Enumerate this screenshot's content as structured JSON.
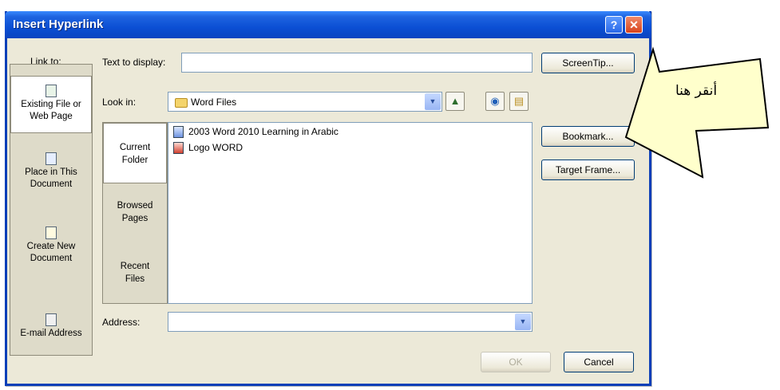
{
  "dialog": {
    "title": "Insert Hyperlink",
    "help_glyph": "?",
    "close_glyph": "✕"
  },
  "link_to": {
    "label": "Link to:",
    "items": [
      {
        "label_line1": "Existing File or",
        "label_line2": "Web Page",
        "icon": "globe-page-icon",
        "active": true
      },
      {
        "label_line1": "Place in This",
        "label_line2": "Document",
        "icon": "document-place-icon",
        "active": false
      },
      {
        "label_line1": "Create New",
        "label_line2": "Document",
        "icon": "new-document-icon",
        "active": false
      },
      {
        "label_line1": "E-mail Address",
        "label_line2": "",
        "icon": "email-icon",
        "active": false
      }
    ]
  },
  "text_to_display": {
    "label": "Text to display:",
    "value": ""
  },
  "look_in": {
    "label": "Look in:",
    "value": "Word Files",
    "icons": [
      "up-folder-icon",
      "browse-web-icon",
      "browse-file-icon"
    ]
  },
  "places": [
    {
      "label_line1": "Current",
      "label_line2": "Folder",
      "active": true
    },
    {
      "label_line1": "Browsed",
      "label_line2": "Pages",
      "active": false
    },
    {
      "label_line1": "Recent",
      "label_line2": "Files",
      "active": false
    }
  ],
  "files": [
    {
      "name": "2003 Word 2010 Learning in Arabic",
      "icon": "word-document-icon"
    },
    {
      "name": "Logo WORD",
      "icon": "image-file-icon"
    }
  ],
  "address": {
    "label": "Address:",
    "value": ""
  },
  "buttons": {
    "screentip": "ScreenTip...",
    "bookmark": "Bookmark...",
    "target_frame": "Target Frame...",
    "ok": "OK",
    "cancel": "Cancel"
  },
  "callout": {
    "text": "أنقر هنا",
    "fill_color": "#ffffcc",
    "stroke_color": "#000000"
  },
  "colors": {
    "title_bar": "#0a4fd4",
    "dialog_bg": "#ece9d8",
    "close_button": "#d8431b"
  }
}
